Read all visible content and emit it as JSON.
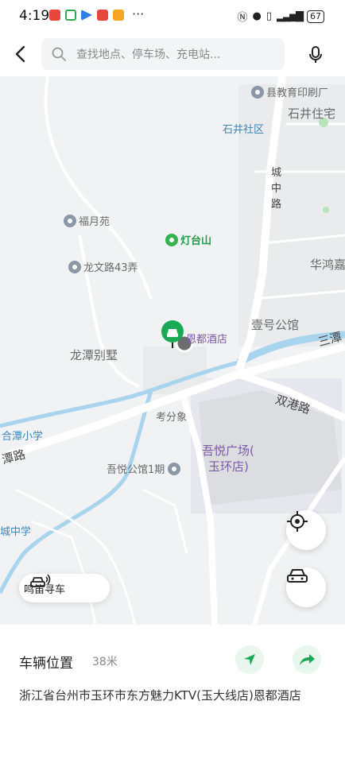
{
  "status_bar": {
    "time": "4:19",
    "battery": "67",
    "more": "···"
  },
  "search": {
    "placeholder": "查找地点、停车场、充电站..."
  },
  "map": {
    "labels": {
      "edu_print": "县教育印刷厂",
      "shijing_zhai": "石井住宅",
      "shijing_community": "石井社区",
      "chengzhong_road": "城中路",
      "fuyue_yuan": "福月苑",
      "dengtai_shan": "灯台山",
      "longwen_road": "龙文路43弄",
      "huahong": "华鸿嘉",
      "yihao_guan": "壹号公馆",
      "endu_hotel": "恩都酒店",
      "longtan_villa": "龙潭别墅",
      "santan": "三潭",
      "shuanggang_road": "双港路",
      "kaofen_xiang": "考分象",
      "hetan_school": "合潭小学",
      "wuyue_plaza_1": "吾悦广场(",
      "wuyue_plaza_2": "玉环店)",
      "tan_road": "潭路",
      "wuyue_gongguan": "吾悦公馆1期",
      "cheng_middle": "城中学"
    }
  },
  "controls": {
    "horn_label": "鸣笛寻车"
  },
  "panel": {
    "title": "车辆位置",
    "distance": "38米",
    "address": "浙江省台州市玉环市东方魅力KTV(玉大线店)恩都酒店"
  },
  "colors": {
    "accent_green": "#1aaa55",
    "water_blue": "#a9d4ee",
    "road": "#ffffff"
  }
}
